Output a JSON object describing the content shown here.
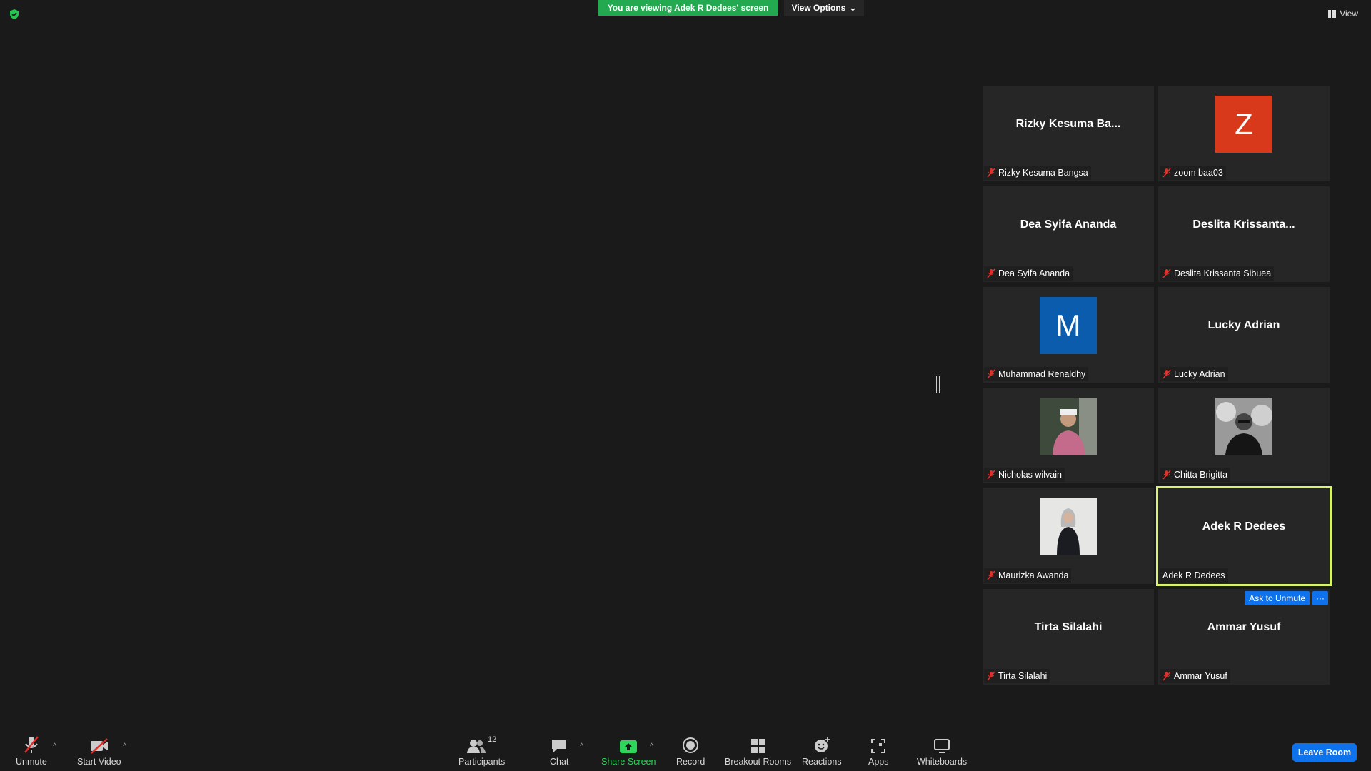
{
  "banner": {
    "viewing_text": "You are viewing Adek R Dedees' screen",
    "view_options_label": "View Options",
    "view_label": "View"
  },
  "gallery": {
    "tiles": [
      {
        "display": "Rizky  Kesuma  Ba...",
        "name": "Rizky Kesuma Bangsa",
        "kind": "name"
      },
      {
        "display": "Z",
        "name": "zoom baa03",
        "kind": "letter",
        "color": "#d9391b"
      },
      {
        "display": "Dea Syifa Ananda",
        "name": "Dea Syifa Ananda",
        "kind": "name"
      },
      {
        "display": "Deslita  Krissanta...",
        "name": "Deslita Krissanta Sibuea",
        "kind": "name"
      },
      {
        "display": "M",
        "name": "Muhammad Renaldhy",
        "kind": "letter",
        "color": "#0b5cad"
      },
      {
        "display": "Lucky Adrian",
        "name": "Lucky Adrian",
        "kind": "name"
      },
      {
        "display": "",
        "name": "Nicholas wilvain",
        "kind": "photo"
      },
      {
        "display": "",
        "name": "Chitta Brigitta",
        "kind": "photo"
      },
      {
        "display": "",
        "name": "Maurizka Awanda",
        "kind": "photo"
      },
      {
        "display": "Adek R Dedees",
        "name": "Adek R Dedees",
        "kind": "name",
        "active": true
      },
      {
        "display": "Tirta Silalahi",
        "name": "Tirta Silalahi",
        "kind": "name"
      },
      {
        "display": "Ammar Yusuf",
        "name": "Ammar Yusuf",
        "kind": "name"
      }
    ],
    "ask_to_unmute_label": "Ask to Unmute",
    "more_label": "···",
    "active_border_color": "#d6f36a",
    "muted_icon_color": "#e0302b"
  },
  "toolbar": {
    "unmute": "Unmute",
    "start_video": "Start Video",
    "participants": "Participants",
    "participants_count": "12",
    "chat": "Chat",
    "share_screen": "Share Screen",
    "record": "Record",
    "breakout_rooms": "Breakout Rooms",
    "reactions": "Reactions",
    "apps": "Apps",
    "whiteboards": "Whiteboards",
    "leave_room": "Leave Room"
  },
  "colors": {
    "share_green": "#2fd45b",
    "banner_green": "#23a94f",
    "accent_blue": "#0e72ed",
    "background": "#1a1a1a"
  }
}
